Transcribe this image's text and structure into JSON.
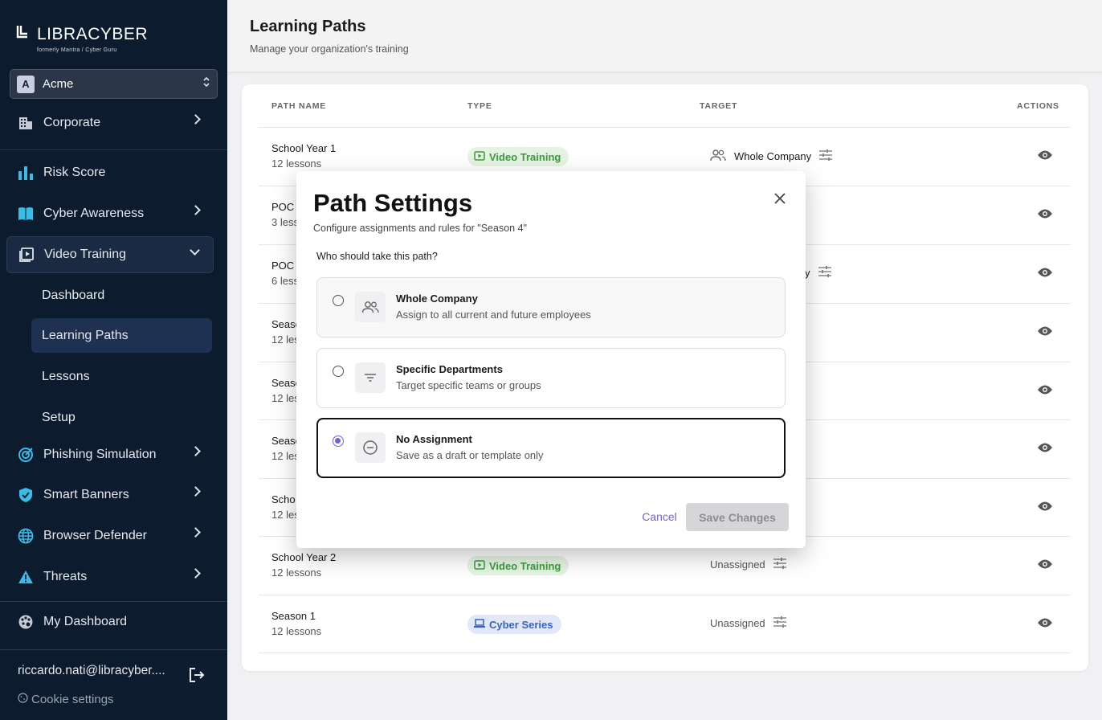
{
  "brand": {
    "name": "LIBRACYBER",
    "formerly": "formerly  Mantra  /  Cyber Guru"
  },
  "org": {
    "initial": "A",
    "name": "Acme"
  },
  "sidebar": {
    "items": [
      {
        "label": "Corporate",
        "icon": "building-icon"
      },
      {
        "label": "Risk Score",
        "icon": "bar-chart-icon"
      },
      {
        "label": "Cyber Awareness",
        "icon": "book-icon"
      },
      {
        "label": "Video Training",
        "icon": "video-icon"
      },
      {
        "label": "Phishing Simulation",
        "icon": "target-icon"
      },
      {
        "label": "Smart Banners",
        "icon": "shield-check-icon"
      },
      {
        "label": "Browser Defender",
        "icon": "globe-icon"
      },
      {
        "label": "Threats",
        "icon": "warning-icon"
      },
      {
        "label": "My Dashboard",
        "icon": "palette-icon"
      }
    ],
    "sub_items": [
      {
        "label": "Dashboard"
      },
      {
        "label": "Learning Paths"
      },
      {
        "label": "Lessons"
      },
      {
        "label": "Setup"
      }
    ],
    "user_email": "riccardo.nati@libracyber....",
    "cookie_settings": "Cookie settings"
  },
  "header": {
    "title": "Learning Paths",
    "subtitle": "Manage your organization's training"
  },
  "table": {
    "columns": [
      "PATH NAME",
      "TYPE",
      "TARGET",
      "ACTIONS"
    ],
    "rows": [
      {
        "name": "School Year 1",
        "lessons": "12 lessons",
        "type": "Video Training",
        "target": "Whole Company"
      },
      {
        "name": "POC C",
        "lessons": "3 less",
        "type": "",
        "target": ""
      },
      {
        "name": "POC A",
        "lessons": "6 less",
        "type": "",
        "target": "y"
      },
      {
        "name": "Seaso",
        "lessons": "12 less",
        "type": "",
        "target": ""
      },
      {
        "name": "Seaso",
        "lessons": "12 less",
        "type": "",
        "target": ""
      },
      {
        "name": "Seaso",
        "lessons": "12 less",
        "type": "",
        "target": ""
      },
      {
        "name": "Scho",
        "lessons": "12 less",
        "type": "",
        "target": ""
      },
      {
        "name": "School Year 2",
        "lessons": "12 lessons",
        "type": "Video Training",
        "target": "Unassigned"
      },
      {
        "name": "Season 1",
        "lessons": "12 lessons",
        "type": "Cyber Series",
        "target": "Unassigned"
      }
    ]
  },
  "modal": {
    "title": "Path Settings",
    "subtitle": "Configure assignments and rules for \"Season 4\"",
    "question": "Who should take this path?",
    "options": [
      {
        "title": "Whole Company",
        "desc": "Assign to all current and future employees",
        "icon": "users-icon",
        "selected": false
      },
      {
        "title": "Specific Departments",
        "desc": "Target specific teams or groups",
        "icon": "filter-icon",
        "selected": false
      },
      {
        "title": "No Assignment",
        "desc": "Save as a draft or template only",
        "icon": "minus-circle-icon",
        "selected": true
      }
    ],
    "cancel_label": "Cancel",
    "save_label": "Save Changes"
  },
  "colors": {
    "sidebar_bg": "#0d1b2e",
    "accent": "#6c63e0",
    "video_badge": "#3d9a3d",
    "cyber_badge": "#3a62c4",
    "icon_cyan": "#38bde8"
  }
}
